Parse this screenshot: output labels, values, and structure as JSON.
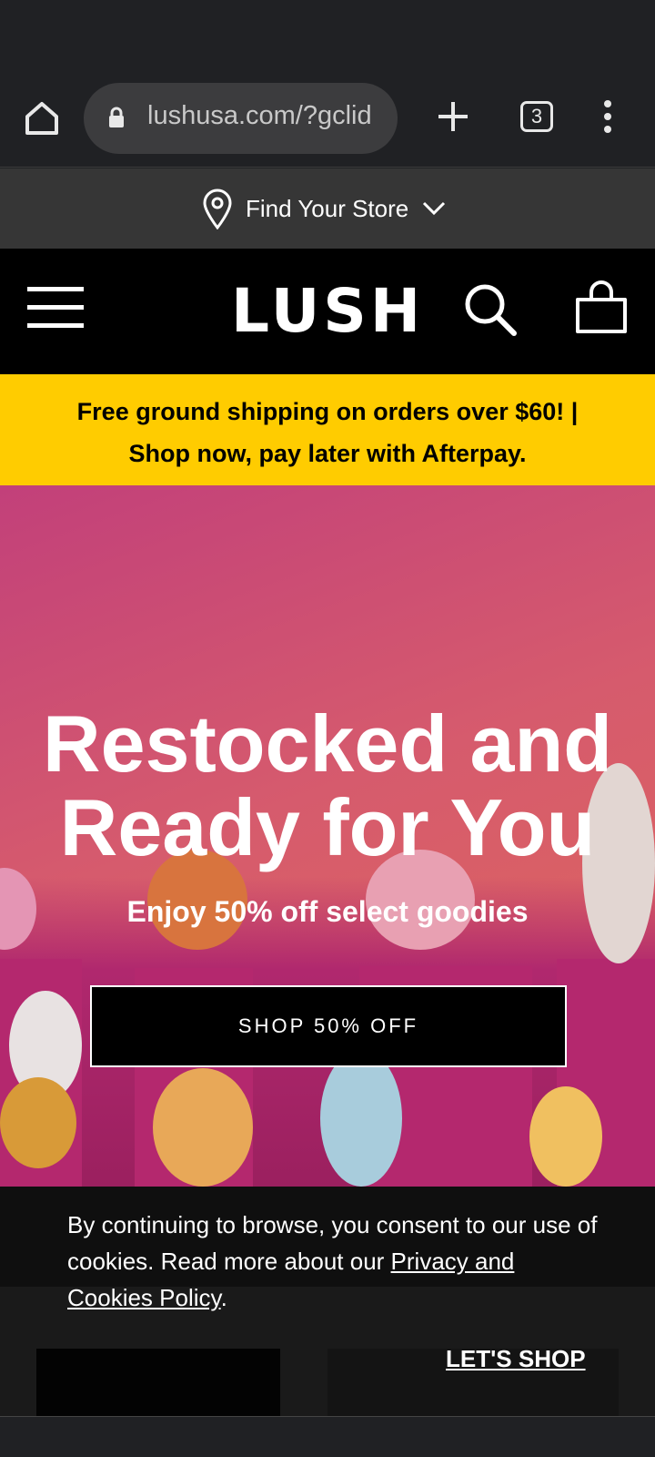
{
  "browser": {
    "url": "lushusa.com/?gclid",
    "tab_count": "3"
  },
  "store_bar": {
    "label": "Find Your Store"
  },
  "header": {
    "logo": "LUSH"
  },
  "promo": {
    "line1": "Free ground shipping on orders over $60! |",
    "line2": "Shop now, pay later with Afterpay."
  },
  "hero": {
    "title_line1": "Restocked and",
    "title_line2": "Ready for You",
    "subtitle": "Enjoy 50% off select goodies",
    "cta_label": "SHOP 50% OFF"
  },
  "cookie_banner": {
    "text": "By continuing to browse, you consent to our use of cookies. Read more about our ",
    "link_text": "Privacy and Cookies Policy",
    "end": ".",
    "accept_label": "LET'S SHOP"
  },
  "colors": {
    "promo_bg": "#ffcc00",
    "nav_bg": "#000000",
    "hero_pink": "#c2407a"
  }
}
